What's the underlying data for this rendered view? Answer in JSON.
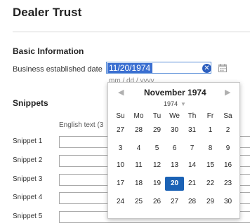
{
  "page": {
    "title": "Dealer Trust"
  },
  "basic_info": {
    "heading": "Basic Information",
    "established_label": "Business established date",
    "established_value": "11/20/1974",
    "date_placeholder": "mm / dd / yyyy",
    "clear_icon": "clear-icon",
    "calendar_icon": "calendar-icon"
  },
  "snippets": {
    "heading": "Snippets",
    "column_english": "English text (3",
    "rows": [
      {
        "label": "Snippet 1"
      },
      {
        "label": "Snippet 2"
      },
      {
        "label": "Snippet 3"
      },
      {
        "label": "Snippet 4"
      },
      {
        "label": "Snippet 5"
      }
    ]
  },
  "calendar": {
    "month_title": "November 1974",
    "year": "1974",
    "weekdays": [
      "Su",
      "Mo",
      "Tu",
      "We",
      "Th",
      "Fr",
      "Sa"
    ],
    "weeks": [
      [
        "27",
        "28",
        "29",
        "30",
        "31",
        "1",
        "2"
      ],
      [
        "3",
        "4",
        "5",
        "6",
        "7",
        "8",
        "9"
      ],
      [
        "10",
        "11",
        "12",
        "13",
        "14",
        "15",
        "16"
      ],
      [
        "17",
        "18",
        "19",
        "20",
        "21",
        "22",
        "23"
      ],
      [
        "24",
        "25",
        "26",
        "27",
        "28",
        "29",
        "30"
      ]
    ],
    "selected_day": "20",
    "prev_glyph": "◀",
    "next_glyph": "▶",
    "year_arrow": "▼",
    "accent_color": "#1b62b5"
  }
}
